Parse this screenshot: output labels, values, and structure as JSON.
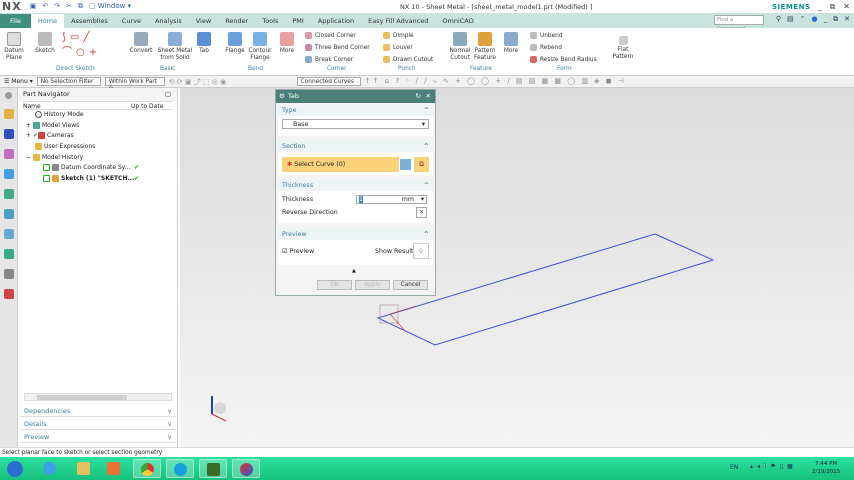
{
  "app": {
    "logo": "NX",
    "title": "NX 10 - Sheet Metal - [sheet_metal_model1.prt (Modified) ]",
    "brand": "SIEMENS",
    "window_menu": "Window"
  },
  "tabs": [
    "File",
    "Home",
    "Assemblies",
    "Curve",
    "Analysis",
    "View",
    "Render",
    "Tools",
    "PMI",
    "Application",
    "Easy Fill Advanced",
    "OmniCAD"
  ],
  "active_tab": "Home",
  "find_command": {
    "placeholder": "Find a Command"
  },
  "ribbon": {
    "datum_plane": "Datum Plane",
    "sketch": "Sketch",
    "convert": "Convert",
    "sheet_metal_from_solid": "Sheet Metal from Solid",
    "tab": "Tab",
    "flange": "Flange",
    "contour_flange": "Contour Flange",
    "more": "More",
    "corner": [
      "Closed Corner",
      "Three Bend Corner",
      "Break Corner"
    ],
    "punch": [
      "Dimple",
      "Louver",
      "Drawn Cutout"
    ],
    "normal_cutout": "Normal Cutout",
    "pattern_feature": "Pattern Feature",
    "form": [
      "Unbend",
      "Rebend",
      "Resize Bend Radius"
    ],
    "flat_pattern": "Flat Pattern",
    "groups": [
      "Direct Sketch",
      "Basic",
      "Bend",
      "Corner",
      "Punch",
      "Feature",
      "Form"
    ]
  },
  "toolbar": {
    "menu": "Menu",
    "selection_filter": "No Selection Filter",
    "scope": "Within Work Part O",
    "curve_rule": "Connected Curves"
  },
  "navigator": {
    "title": "Part Navigator",
    "columns": [
      "Name",
      "Up to Date"
    ],
    "items": [
      {
        "label": "History Mode",
        "level": 1,
        "check": false
      },
      {
        "label": "Model Views",
        "level": 1,
        "check": false
      },
      {
        "label": "Cameras",
        "level": 1,
        "check": false
      },
      {
        "label": "User Expressions",
        "level": 1,
        "check": false
      },
      {
        "label": "Model History",
        "level": 1,
        "check": false
      },
      {
        "label": "Datum Coordinate Sy...",
        "level": 2,
        "check": true
      },
      {
        "label": "Sketch (1) \"SKETCH...",
        "level": 2,
        "check": true
      }
    ],
    "panels": [
      "Dependencies",
      "Details",
      "Preview"
    ]
  },
  "dialog": {
    "title": "Tab",
    "type": {
      "header": "Type",
      "value": "Base"
    },
    "section": {
      "header": "Section",
      "select": "Select Curve (0)"
    },
    "thickness": {
      "header": "Thickness",
      "label": "Thickness",
      "value": "1",
      "unit": "mm",
      "reverse": "Reverse Direction"
    },
    "preview": {
      "header": "Preview",
      "checkbox": "Preview",
      "checked": true,
      "show_result": "Show Result"
    },
    "buttons": {
      "ok": "OK",
      "apply": "Apply",
      "cancel": "Cancel"
    }
  },
  "status": "Select planar face to sketch or select section geometry",
  "tray": {
    "lang": "EN",
    "time": "7:44 PM",
    "date": "2/19/2015"
  },
  "colors": {
    "accent": "#3a7fa0",
    "dialog_header": "#4d7f7a",
    "selection": "#f9d27a",
    "sketch": "#3c4fe0",
    "taskbar": "#1fcf8f"
  }
}
